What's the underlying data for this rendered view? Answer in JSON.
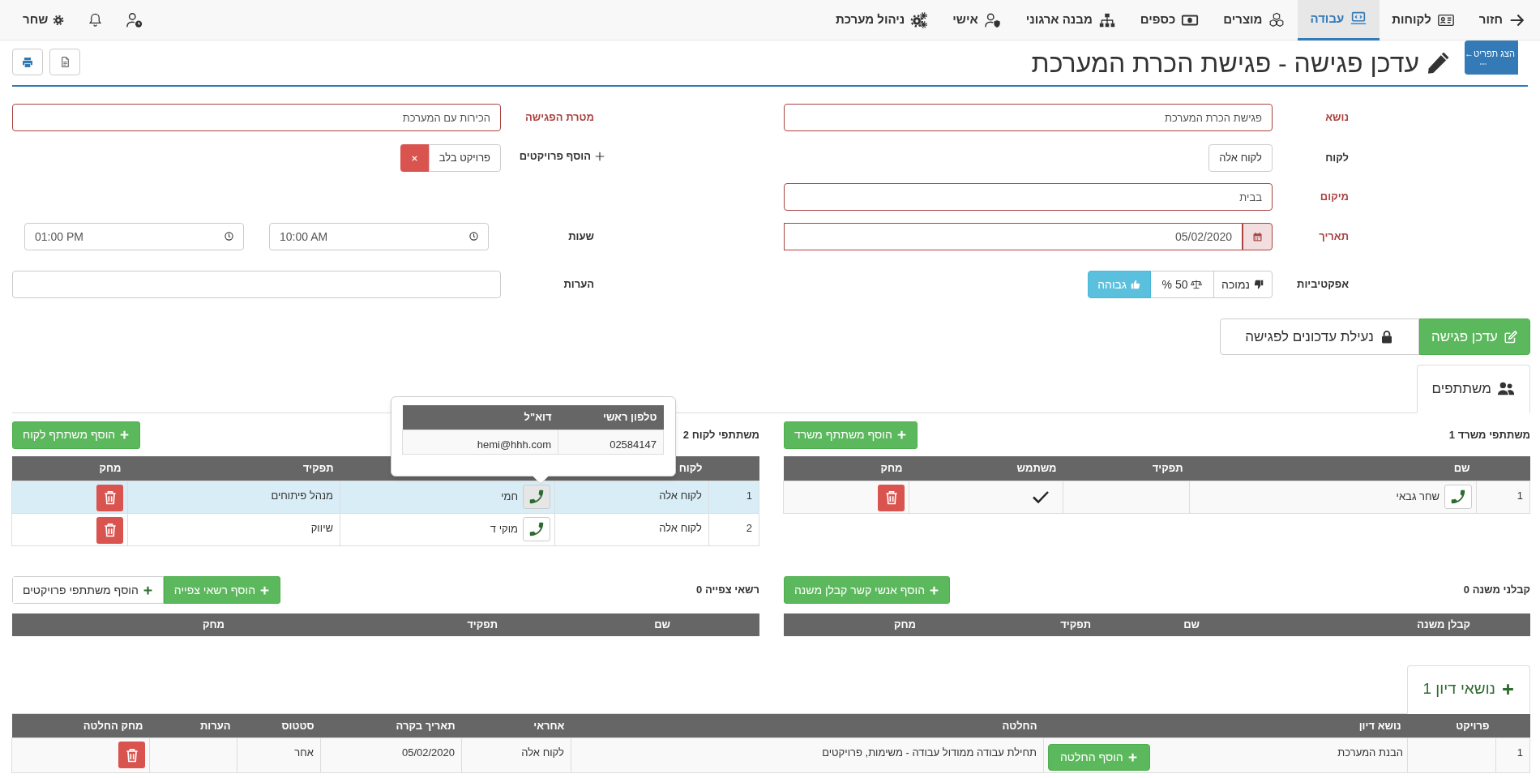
{
  "nav": {
    "items": [
      {
        "label": "חזור",
        "selected": false
      },
      {
        "label": "לקוחות",
        "selected": false
      },
      {
        "label": "עבודה",
        "selected": true
      },
      {
        "label": "מוצרים",
        "selected": false
      },
      {
        "label": "כספים",
        "selected": false
      },
      {
        "label": "מבנה ארגוני",
        "selected": false
      },
      {
        "label": "אישי",
        "selected": false
      },
      {
        "label": "ניהול מערכת",
        "selected": false
      }
    ],
    "user": "שחר"
  },
  "menu_toggle": "הצג תפריט←",
  "page_title": "עדכן פגישה - פגישת הכרת המערכת",
  "form": {
    "rows": [
      {
        "right": {
          "kind": "text",
          "label": "נושא",
          "value": "פגישת הכרת המערכת",
          "error": true
        },
        "left": {
          "kind": "text",
          "label": "מטרת הפגישה",
          "value": "הכירות עם המערכת",
          "error": true
        }
      },
      {
        "right": {
          "kind": "select",
          "label": "לקוח",
          "value": "לקוח אלה",
          "error": false
        },
        "left": {
          "kind": "tags",
          "label": "הוסף פרויקטים",
          "tags": [
            "פרויקט בלב"
          ]
        }
      },
      {
        "right": {
          "kind": "text",
          "label": "מיקום",
          "value": "בבית",
          "error": true
        }
      },
      {
        "right": {
          "kind": "date",
          "label": "תאריך",
          "value": "05/02/2020",
          "error": true
        },
        "left": {
          "kind": "time",
          "label": "שעות",
          "from": "10:00 AM",
          "to": "01:00 PM"
        }
      },
      {
        "right": {
          "kind": "options",
          "label": "אפקטיביות",
          "options": [
            {
              "label": "נמוכה",
              "selected": false
            },
            {
              "label": "50 %",
              "selected": false
            },
            {
              "label": "גבוהה",
              "selected": true
            }
          ]
        },
        "left": {
          "kind": "text",
          "label": "הערות",
          "error": false
        }
      }
    ]
  },
  "actions": [
    {
      "label": "עדכן פגישה",
      "kind": "primary"
    },
    {
      "label": "נעילת עדכונים לפגישה",
      "kind": "default"
    }
  ],
  "participants_tab": {
    "label": "משתתפים",
    "selected": true
  },
  "office": {
    "title": "משתתפי משרד 1",
    "add_button": "הוסף משתתף משרד",
    "columns": [
      "שם",
      "תפקיד",
      "משתמש",
      "מחק"
    ],
    "rows": [
      {
        "index": "1",
        "name": "שחר גבאי",
        "is_user": true,
        "selected": false
      }
    ]
  },
  "client": {
    "title": "משתתפי לקוח 2",
    "add_button": "הוסף משתתף לקוח",
    "columns": [
      "לקוח",
      "תפקיד",
      "מחק"
    ],
    "rows": [
      {
        "index": "1",
        "client": "לקוח אלה",
        "name": "חמי",
        "role": "מנהל פיתוחים",
        "selected": true
      },
      {
        "index": "2",
        "client": "לקוח אלה",
        "name": "מוקי ד",
        "role": "שיווק",
        "selected": false
      }
    ],
    "popover": {
      "columns": [
        "טלפון ראשי",
        "דוא\"ל"
      ],
      "values": [
        "02584147",
        "hemi@hhh.com"
      ]
    }
  },
  "viewers": {
    "title": "רשאי צפייה 0",
    "buttons": [
      {
        "label": "הוסף רשאי צפייה",
        "kind": "success"
      },
      {
        "label": "הוסף משתתפי פרויקטים",
        "kind": "default"
      }
    ],
    "columns": [
      "שם",
      "תפקיד",
      "מחק"
    ]
  },
  "subcontractors": {
    "title": "קבלני משנה 0",
    "add_button": "הוסף אנשי קשר קבלן משנה",
    "columns": [
      "קבלן משנה",
      "שם",
      "תפקיד",
      "מחק"
    ]
  },
  "topics_tab": {
    "label": "נושאי דיון 1",
    "selected": true
  },
  "topics": {
    "columns": [
      "פרויקט",
      "נושא דיון",
      "החלטה",
      "אחראי",
      "תאריך בקרה",
      "סטטוס",
      "הערות",
      "מחק החלטה"
    ],
    "rows": [
      {
        "index": "1",
        "topic": "הבנת המערכת",
        "add_decision": "הוסף החלטה",
        "decision": "תחילת עבודה ממודול עבודה - משימות, פרויקטים",
        "owner": "לקוח אלה",
        "review_date": "05/02/2020",
        "status": "אחר"
      }
    ]
  }
}
